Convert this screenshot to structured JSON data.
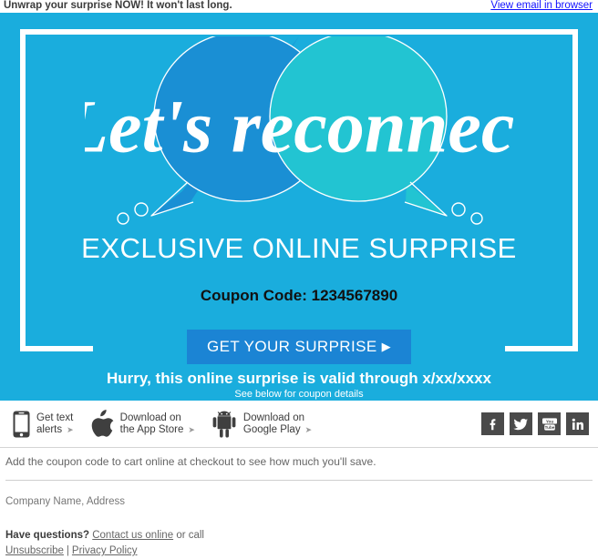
{
  "preheader": {
    "text": "Unwrap your surprise NOW! It won't last long.",
    "browser_link": "View email in browser"
  },
  "hero": {
    "background_color": "#1aaddd",
    "frame_color": "#ffffff",
    "script_headline": "Let's reconnect",
    "bubble_left_color": "#1a8fd4",
    "bubble_right_color": "#22c4d2",
    "subheadline": "EXCLUSIVE ONLINE SURPRISE",
    "coupon_label": "Coupon Code: 1234567890",
    "cta_label": "GET YOUR SURPRISE",
    "cta_arrow": "▶",
    "cta_color": "#1b84d4",
    "urgency": "Hurry, this online surprise is valid through x/xx/xxxx",
    "fineprint": "See below for coupon details"
  },
  "appbar": {
    "links": [
      {
        "icon": "mobile-phone-icon",
        "line1": "Get text",
        "line2": "alerts",
        "caret": "➤"
      },
      {
        "icon": "apple-logo-icon",
        "line1": "Download on",
        "line2": "the App Store",
        "caret": "➤"
      },
      {
        "icon": "android-robot-icon",
        "line1": "Download on",
        "line2": "Google Play",
        "caret": "➤"
      }
    ],
    "social": [
      {
        "name": "facebook-icon",
        "glyph": "f"
      },
      {
        "name": "twitter-icon",
        "glyph": "t"
      },
      {
        "name": "youtube-icon",
        "glyph": "yt"
      },
      {
        "name": "linkedin-icon",
        "glyph": "in"
      }
    ],
    "social_color": "#4a4a4a"
  },
  "footer": {
    "note": "Add the coupon code to cart online at checkout to see how much you'll save.",
    "company": "Company Name, Address",
    "questions_bold": "Have questions?",
    "contact_link": "Contact us online",
    "questions_tail": "or call",
    "unsubscribe": "Unsubscribe",
    "separator": "|",
    "privacy": "Privacy Policy"
  }
}
